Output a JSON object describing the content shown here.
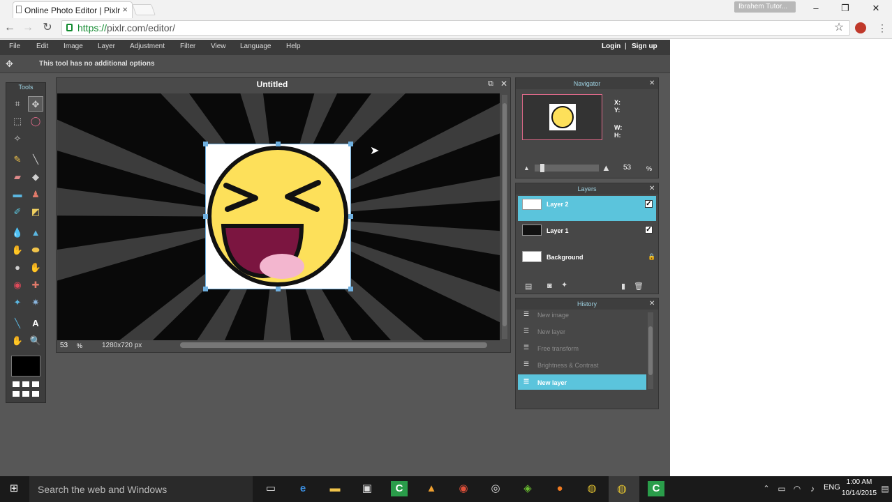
{
  "browser": {
    "tab_title": "Online Photo Editor | Pixlr",
    "url_scheme": "https://",
    "url_rest": "pixlr.com/editor/",
    "profile_name": "Ibrahem Tutor...",
    "minimize": "–",
    "restore": "❐",
    "close": "✕",
    "tab_close": "×"
  },
  "menu": {
    "items": [
      "File",
      "Edit",
      "Image",
      "Layer",
      "Adjustment",
      "Filter",
      "View",
      "Language",
      "Help"
    ],
    "login": "Login",
    "separator": "|",
    "signup": "Sign up"
  },
  "options_bar": {
    "text": "This tool has no additional options"
  },
  "tools": {
    "title": "Tools"
  },
  "document": {
    "title": "Untitled",
    "zoom": "53",
    "zoom_unit": "%",
    "dimensions": "1280x720 px"
  },
  "navigator": {
    "title": "Navigator",
    "x_label": "X:",
    "y_label": "Y:",
    "w_label": "W:",
    "h_label": "H:",
    "zoom": "53",
    "zoom_unit": "%"
  },
  "layers": {
    "title": "Layers",
    "items": [
      {
        "name": "Layer 2",
        "selected": true,
        "visible": true
      },
      {
        "name": "Layer 1",
        "selected": false,
        "visible": true
      },
      {
        "name": "Background",
        "selected": false,
        "locked": true
      }
    ]
  },
  "history": {
    "title": "History",
    "items": [
      "New image",
      "New layer",
      "Free transform",
      "Brightness & Contrast",
      "New layer"
    ],
    "active_index": 4
  },
  "taskbar": {
    "search_placeholder": "Search the web and Windows",
    "language": "ENG",
    "time": "1:00 AM",
    "date": "10/14/2015"
  },
  "colors": {
    "accent": "#5bc4dc",
    "app_bg": "#575757",
    "smiley_yellow": "#fde05a",
    "mouth": "#7b1540",
    "tongue": "#f3b6cf"
  }
}
